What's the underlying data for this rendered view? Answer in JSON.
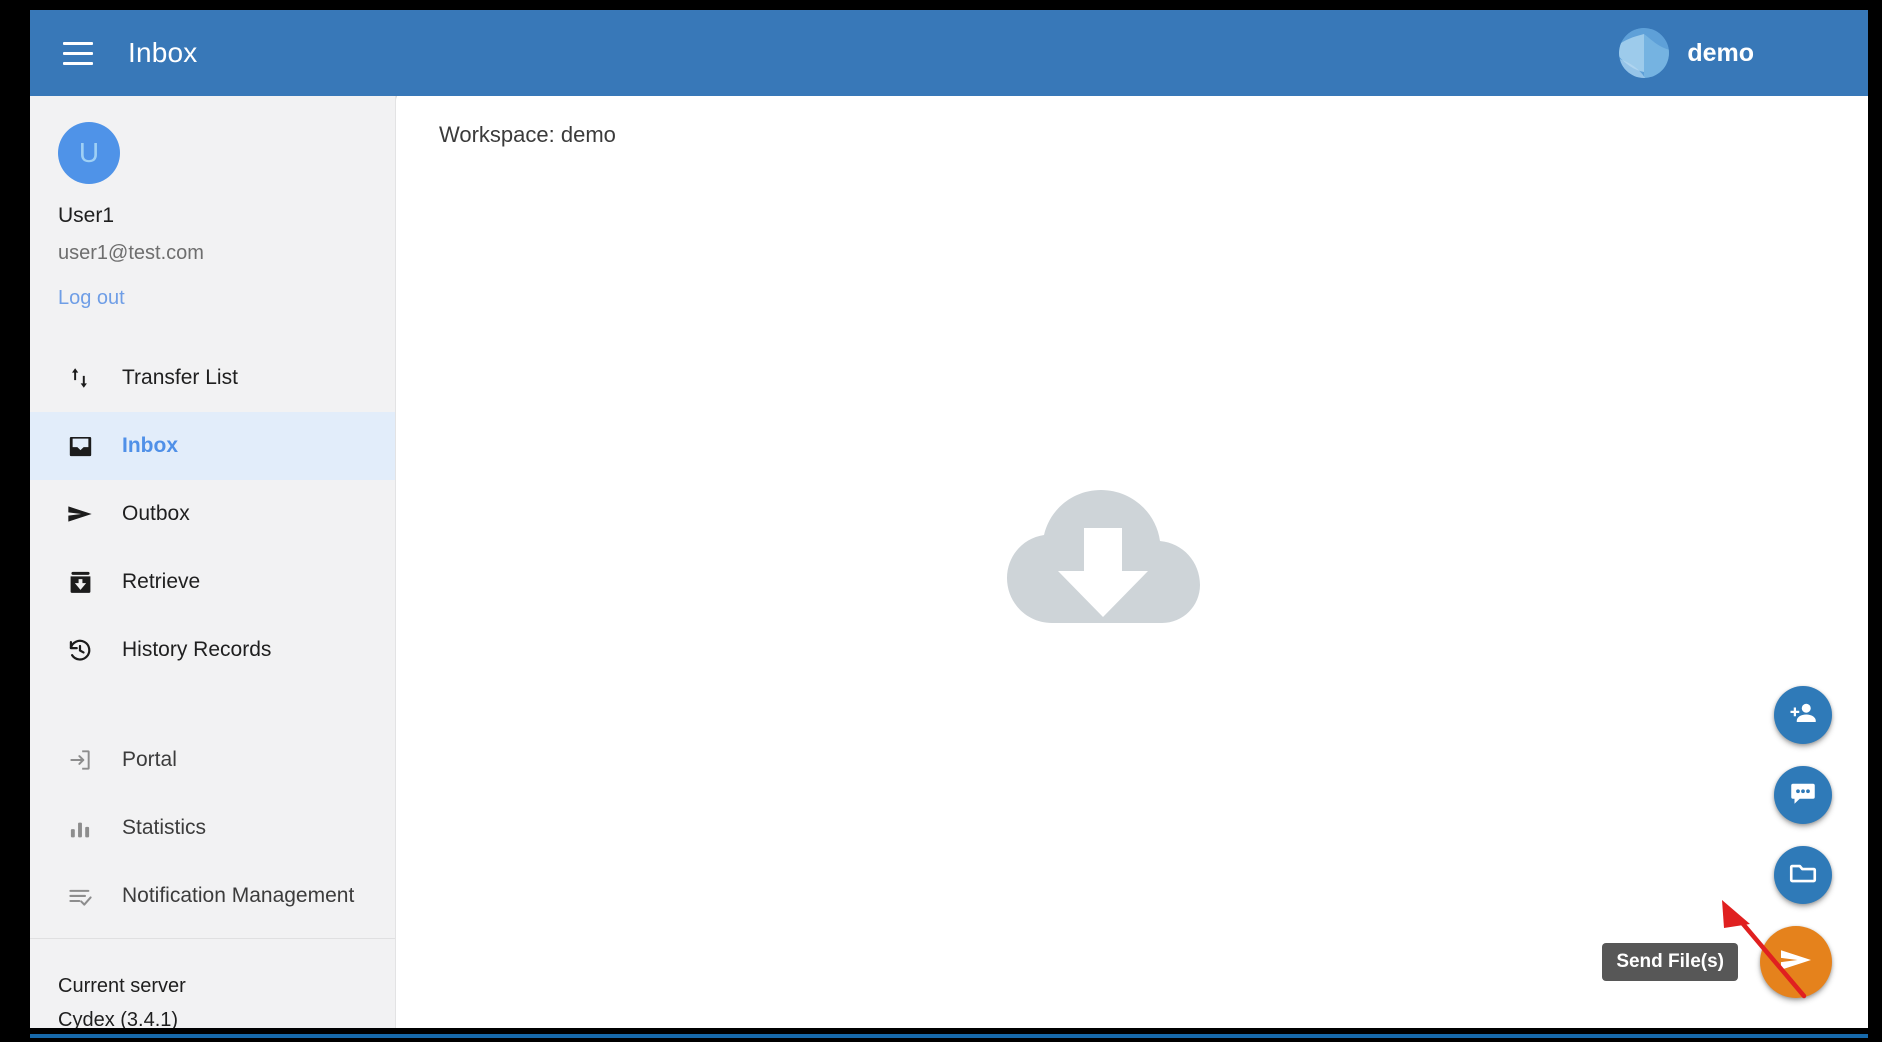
{
  "appbar": {
    "menu_icon": "hamburger-menu-icon",
    "title": "Inbox",
    "workspace_user": "demo",
    "avatar_icon": "workspace-avatar-image",
    "background_color": "#3878b8"
  },
  "sidebar": {
    "user": {
      "avatar_initial": "U",
      "name": "User1",
      "email": "user1@test.com",
      "logout_label": "Log out",
      "avatar_color": "#4f93e8",
      "link_color": "#6f9ee6"
    },
    "nav_groups": [
      {
        "items": [
          {
            "label": "Transfer List",
            "icon": "transfer-arrows-icon",
            "active": false,
            "muted": false
          },
          {
            "label": "Inbox",
            "icon": "inbox-tray-icon",
            "active": true,
            "muted": false
          },
          {
            "label": "Outbox",
            "icon": "send-arrow-icon",
            "active": false,
            "muted": false
          },
          {
            "label": "Retrieve",
            "icon": "download-box-icon",
            "active": false,
            "muted": false
          },
          {
            "label": "History Records",
            "icon": "history-clock-icon",
            "active": false,
            "muted": false
          }
        ]
      },
      {
        "items": [
          {
            "label": "Portal",
            "icon": "login-portal-icon",
            "active": false,
            "muted": true
          },
          {
            "label": "Statistics",
            "icon": "bar-chart-icon",
            "active": false,
            "muted": true
          },
          {
            "label": "Notification Management",
            "icon": "checklist-icon",
            "active": false,
            "muted": true
          }
        ]
      }
    ],
    "footer": {
      "server_label": "Current server",
      "server_value": "Cydex (3.4.1)"
    },
    "active_highlight_color": "#e2edfa",
    "active_text_color": "#4f90e8",
    "background_color": "#f2f2f3"
  },
  "content": {
    "workspace_text": "Workspace: demo",
    "empty_state_icon": "cloud-download-icon",
    "empty_state_color": "#ced4d8",
    "background_color": "#ffffff"
  },
  "fabs": [
    {
      "name": "add-contact-fab",
      "icon": "person-add-icon",
      "color": "#2f7ab8",
      "tooltip": ""
    },
    {
      "name": "messages-fab",
      "icon": "chat-bubble-icon",
      "color": "#2f7ab8",
      "tooltip": ""
    },
    {
      "name": "folder-fab",
      "icon": "folder-icon",
      "color": "#2f7ab8",
      "tooltip": ""
    },
    {
      "name": "send-files-fab",
      "icon": "send-arrow-icon",
      "color": "#e5821c",
      "tooltip": "Send File(s)"
    }
  ],
  "annotation": {
    "arrow_icon": "red-pointer-arrow",
    "color": "#e02020"
  }
}
